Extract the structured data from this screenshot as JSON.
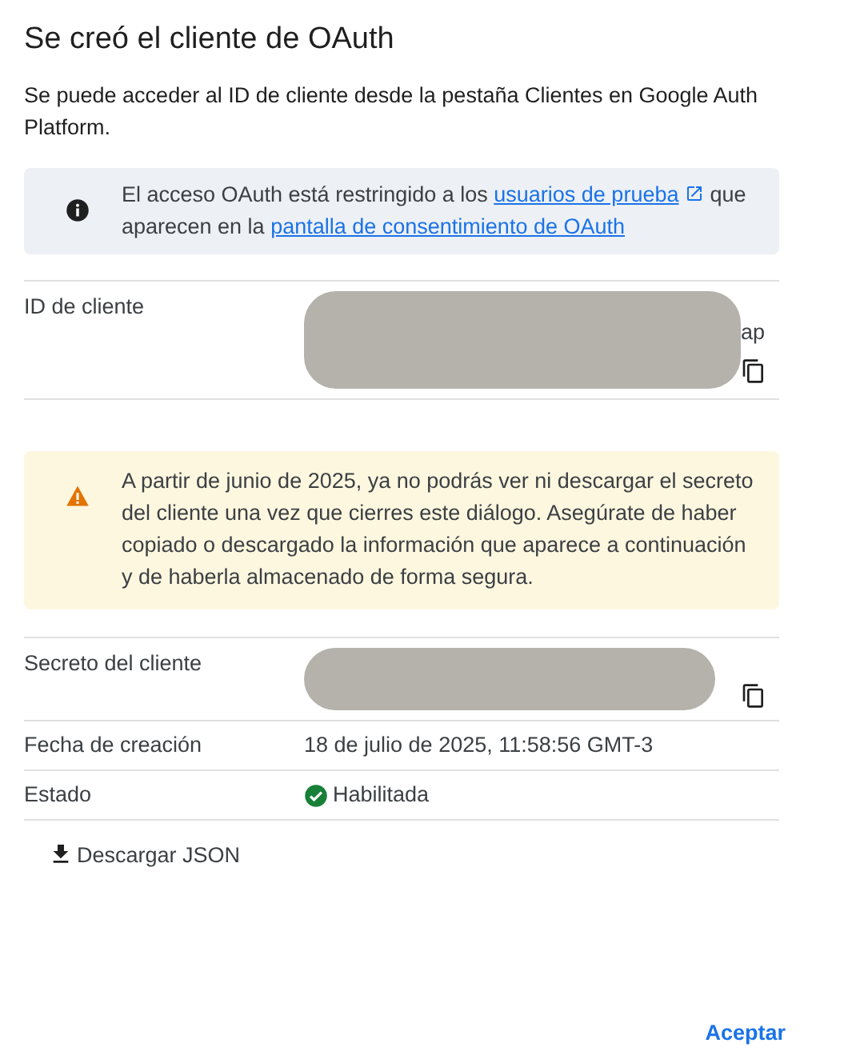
{
  "dialog": {
    "title": "Se creó el cliente de OAuth",
    "description": "Se puede acceder al ID de cliente desde la pestaña Clientes en Google Auth Platform."
  },
  "info_notice": {
    "text_before": "El acceso OAuth está restringido a los",
    "link_1": "usuarios de prueba",
    "text_middle": "que aparecen en la",
    "link_2": "pantalla de consentimiento de OAuth"
  },
  "id_row": {
    "label": "ID de cliente",
    "kind": "redacted",
    "value_tail": "ap"
  },
  "warning_notice": {
    "text": "A partir de junio de 2025, ya no podrás ver ni descargar el secreto del cliente una vez que cierres este diálogo. Asegúrate de haber copiado o descargado la información que aparece a continuación y de haberla almacenado de forma segura."
  },
  "rows": [
    {
      "label": "Secreto del cliente",
      "kind": "redacted"
    },
    {
      "label": "Fecha de creación",
      "kind": "text",
      "value": "18 de julio de 2025, 11:58:56 GMT-3"
    },
    {
      "label": "Estado",
      "kind": "status",
      "value": "Habilitada"
    }
  ],
  "download_button": "Descargar JSON",
  "accept_button": "Aceptar"
}
